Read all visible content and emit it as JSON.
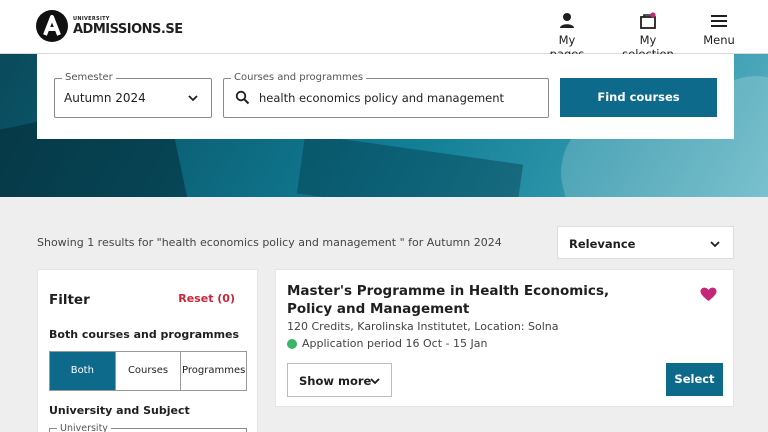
{
  "brand": {
    "small": "UNIVERSITY",
    "big": "ADMISSIONS.SE"
  },
  "nav": {
    "my_pages": "My pages",
    "my_selection": "My selection",
    "menu": "Menu"
  },
  "search": {
    "semester_legend": "Semester",
    "semester_value": "Autumn 2024",
    "courses_legend": "Courses and programmes",
    "courses_value": "health economics policy and management",
    "find_label": "Find courses"
  },
  "results": {
    "summary": "Showing 1 results for \"health economics policy and management \" for Autumn 2024",
    "sort_value": "Relevance"
  },
  "filter": {
    "title": "Filter",
    "reset": "Reset (0)",
    "type_label": "Both courses and programmes",
    "type_options": [
      "Both",
      "Courses",
      "Programmes"
    ],
    "type_selected": "Both",
    "uni_label": "University and Subject",
    "uni_legend": "University"
  },
  "result_card": {
    "title": "Master's Programme in Health Economics, Policy and Management",
    "meta": "120 Credits, Karolinska Institutet, Location: Solna",
    "period": "Application period 16 Oct - 15 Jan",
    "show_more": "Show more",
    "select": "Select",
    "favorited": true
  },
  "colors": {
    "primary": "#0e6a8a",
    "reset": "#c8273a",
    "heart": "#c2277a",
    "open_dot": "#3bb56a"
  },
  "icons": [
    "person-icon",
    "selection-bag-icon",
    "hamburger-icon",
    "chevron-down-icon",
    "search-icon",
    "heart-icon"
  ]
}
